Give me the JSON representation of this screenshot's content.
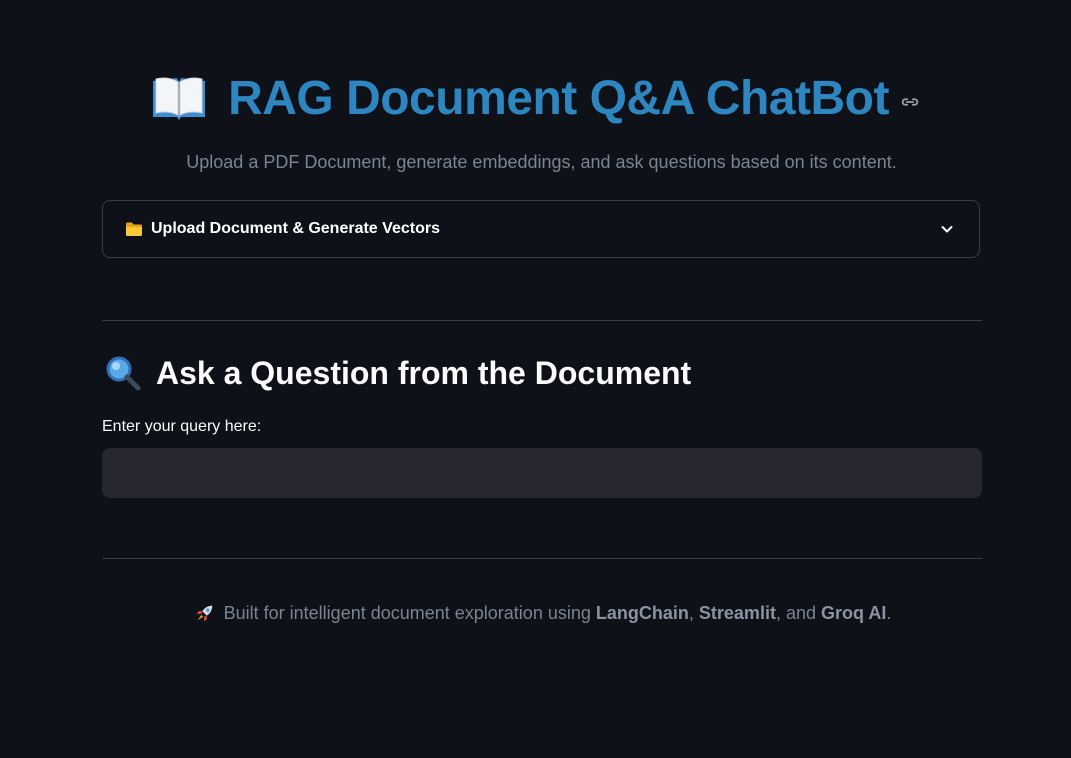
{
  "header": {
    "title_icon": "open-book-icon",
    "title": "RAG Document Q&A ChatBot",
    "anchor_icon": "link-icon",
    "subtitle": "Upload a PDF Document, generate embeddings, and ask questions based on its content."
  },
  "expander": {
    "icon": "folder-icon",
    "label": "Upload Document & Generate Vectors",
    "chevron_icon": "chevron-down-icon",
    "expanded": false
  },
  "query_section": {
    "icon": "magnifying-glass-icon",
    "title": "Ask a Question from the Document",
    "input_label": "Enter your query here:",
    "input_value": ""
  },
  "footer": {
    "icon": "rocket-icon",
    "prefix": "Built for intelligent document exploration using",
    "tech1": "LangChain",
    "sep1": ",",
    "tech2": "Streamlit",
    "sep2": ", and",
    "tech3": "Groq AI",
    "suffix": "."
  },
  "colors": {
    "background": "#0e1117",
    "title": "#2e86c1",
    "muted_text": "#7a8494",
    "input_bg": "#262730",
    "border": "#3a3d46"
  }
}
